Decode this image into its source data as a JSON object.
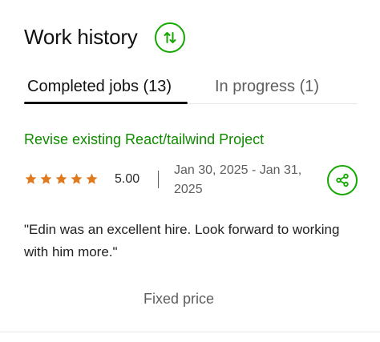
{
  "header": {
    "title": "Work history"
  },
  "tabs": [
    {
      "label": "Completed jobs (13)",
      "active": true
    },
    {
      "label": "In progress (1)",
      "active": false
    }
  ],
  "job": {
    "title": "Revise existing React/tailwind Project",
    "rating_stars": 5,
    "rating": "5.00",
    "dates": "Jan 30, 2025 - Jan 31, 2025",
    "review": "\"Edin was an excellent hire. Look forward to working with him more.\"",
    "price_type": "Fixed price"
  },
  "icons": {
    "sort": "sort-arrows-icon",
    "star": "star-icon",
    "share": "share-icon"
  },
  "colors": {
    "accent_green": "#14a800",
    "link_green": "#108a00",
    "star_orange": "#e07a1f",
    "text_dark": "#111111",
    "text_muted": "#5e5e5e"
  }
}
